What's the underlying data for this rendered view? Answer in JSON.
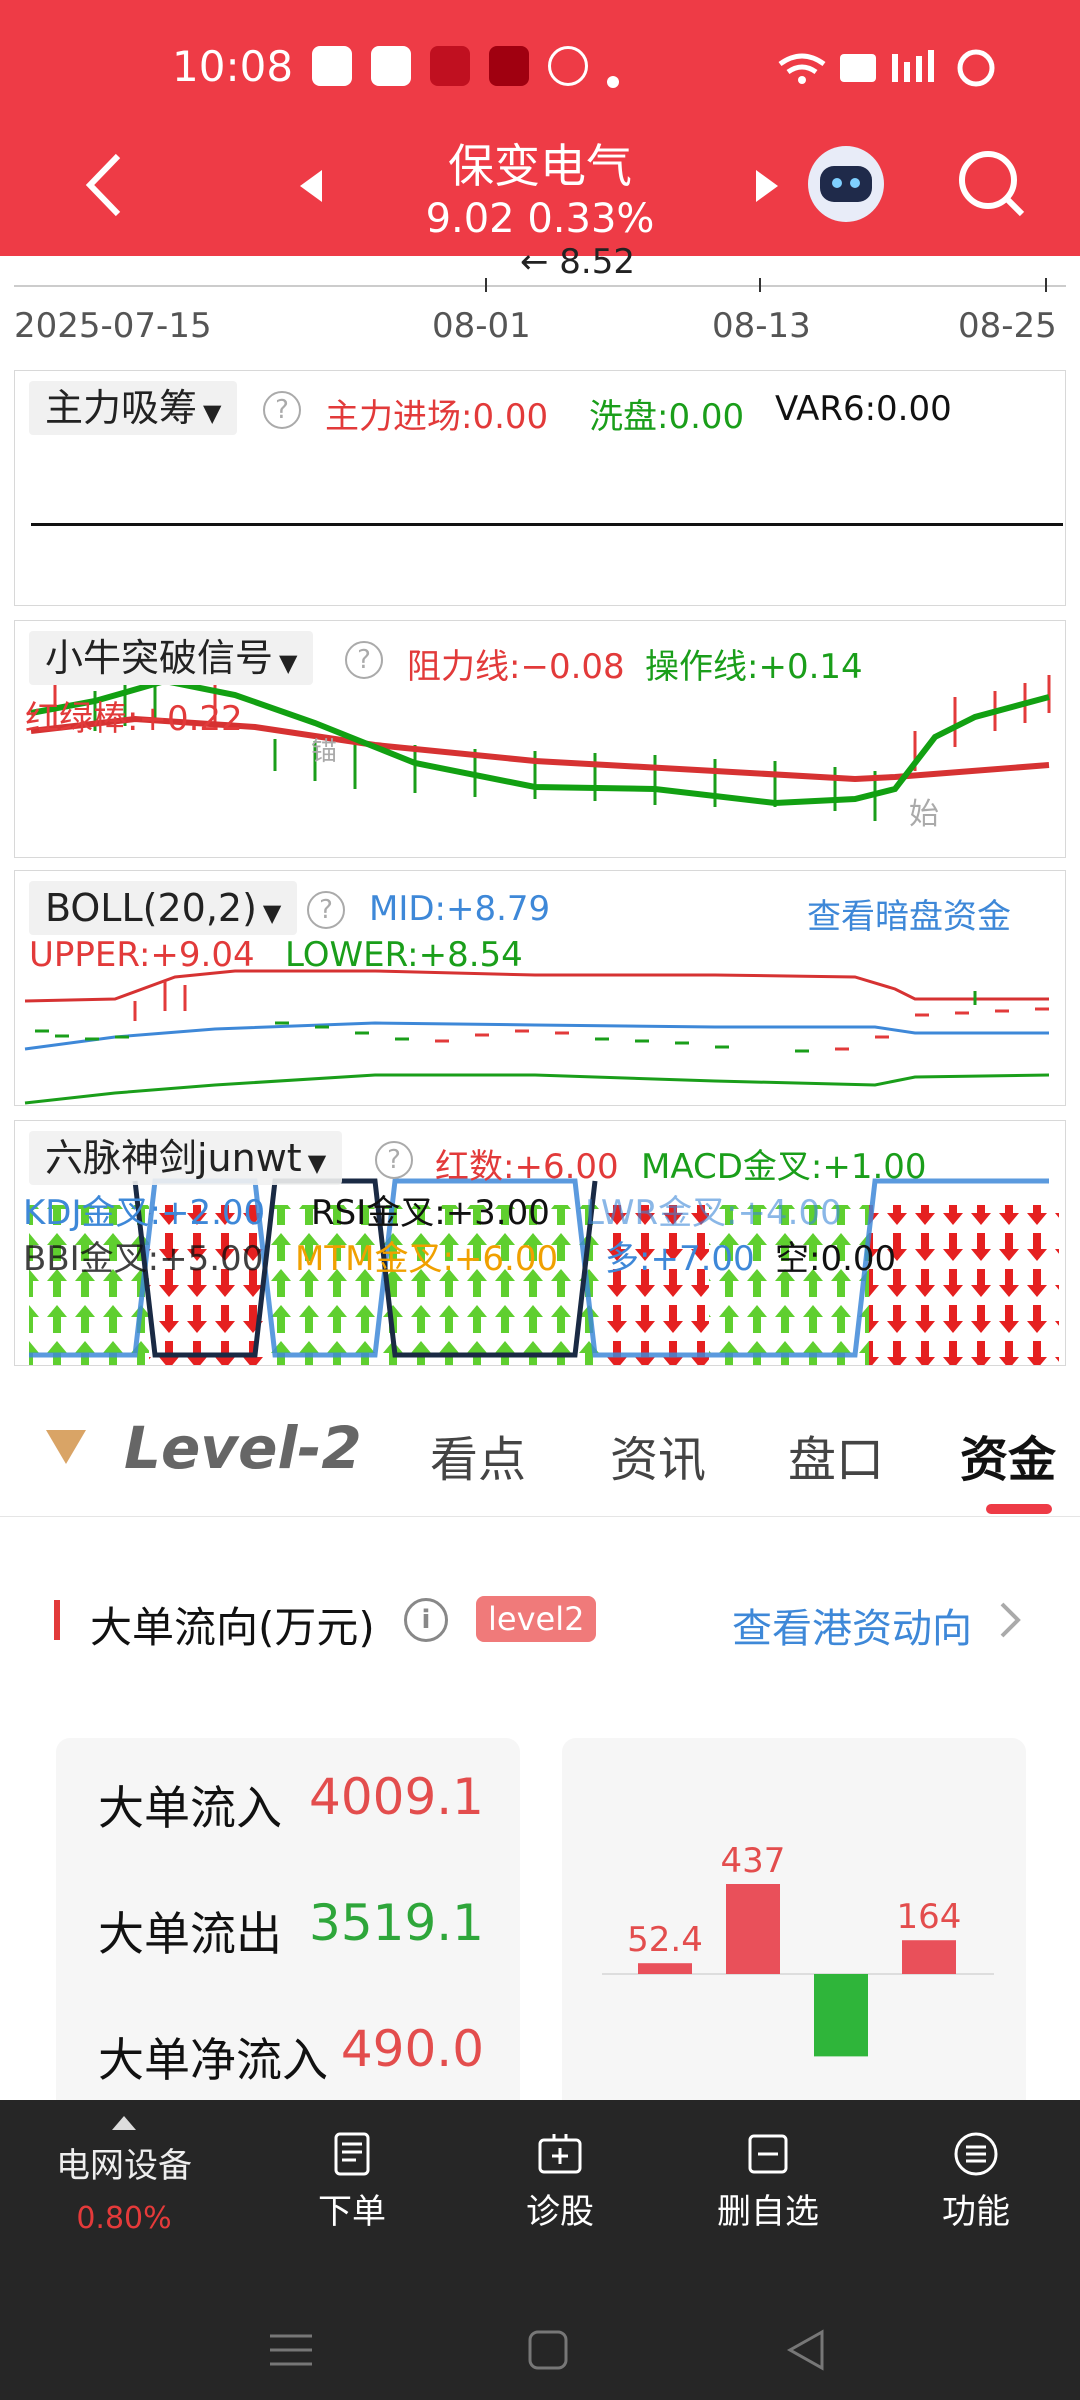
{
  "status": {
    "time": "10:08"
  },
  "header": {
    "title": "保变电气",
    "subtitle": "9.02 0.33%",
    "arrow_label": "← 8.52"
  },
  "chart_axis": {
    "dates": [
      "2025-07-15",
      "08-01",
      "08-13",
      "08-25"
    ]
  },
  "panel1": {
    "selector": "主力吸筹",
    "labels": [
      {
        "text": "主力进场:0.00",
        "color": "red"
      },
      {
        "text": "洗盘:0.00",
        "color": "green"
      },
      {
        "text": "VAR6:0.00",
        "color": "black"
      }
    ]
  },
  "panel2": {
    "selector": "小牛突破信号",
    "resist": "阻力线:−0.08",
    "operate": "操作线:+0.14",
    "redgreen": "红绿棒:+0.22",
    "mark_start": "始",
    "mark_anchor": "锚"
  },
  "panel3": {
    "selector": "BOLL(20,2)",
    "mid": "MID:+8.79",
    "link": "查看暗盘资金",
    "upper": "UPPER:+9.04",
    "lower": "LOWER:+8.54"
  },
  "panel4": {
    "selector": "六脉神剑junwt",
    "row1": [
      {
        "text": "红数:+6.00",
        "color": "red"
      },
      {
        "text": "MACD金叉:+1.00",
        "color": "green"
      }
    ],
    "row2": [
      {
        "text": "KDJ金叉:+2.00",
        "color": "blue"
      },
      {
        "text": "RSI金叉:+3.00",
        "color": "black"
      },
      {
        "text": "LWR金叉:+4.00",
        "color": "blue"
      }
    ],
    "row3": [
      {
        "text": "BBI金叉:+5.00",
        "color": "black"
      },
      {
        "text": "MTM金叉:+6.00",
        "color": "orange"
      },
      {
        "text": "多:+7.00",
        "color": "blue"
      },
      {
        "text": "空:0.00",
        "color": "black"
      }
    ]
  },
  "tabs": {
    "brand": "Level-2",
    "items": [
      "看点",
      "资讯",
      "盘口",
      "资金"
    ],
    "active": "资金"
  },
  "flow": {
    "title": "大单流向(万元)",
    "badge": "level2",
    "link": "查看港资动向",
    "stats": [
      {
        "label": "大单流入",
        "value": "4009.1",
        "color": "red"
      },
      {
        "label": "大单流出",
        "value": "3519.1",
        "color": "green"
      },
      {
        "label": "大单净流入",
        "value": "490.0",
        "color": "red"
      }
    ],
    "bars": [
      {
        "label": "52.4",
        "value": 52.4,
        "color": "#e9505a"
      },
      {
        "label": "437",
        "value": 437,
        "color": "#e9505a"
      },
      {
        "label": "",
        "value": -400,
        "color": "#2fb53a"
      },
      {
        "label": "164",
        "value": 164,
        "color": "#e9505a"
      }
    ]
  },
  "bottom_bar": {
    "sector_name": "电网设备",
    "sector_change": "0.80%",
    "items": [
      "下单",
      "诊股",
      "删自选",
      "功能"
    ]
  }
}
